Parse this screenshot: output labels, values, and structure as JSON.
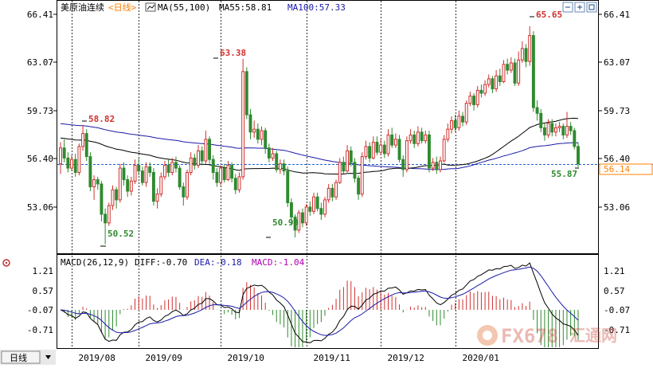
{
  "header": {
    "instrument": "美原油连续",
    "period": "<日线>",
    "ma_label": "MA(55,100)",
    "ma55_label": "MA55:58.81",
    "ma100_label": "MA100:57.33"
  },
  "price_axis": {
    "ticks": [
      "66.41",
      "63.07",
      "59.73",
      "56.40",
      "53.06"
    ],
    "current_price_tag": "56.14"
  },
  "annotations": {
    "high_label": "65.65",
    "peak_sep": "63.38",
    "start_label": "58.82",
    "low_aug": "50.52",
    "low_oct": "50.99",
    "last_low": "55.87"
  },
  "macd": {
    "header_label": "MACD(26,12,9)",
    "diff_label": "DIFF:-0.70",
    "dea_label": "DEA:-0.18",
    "macd_label": "MACD:-1.04",
    "ticks": [
      "1.21",
      "0.57",
      "-0.07",
      "-0.71"
    ]
  },
  "time_axis": {
    "period_button": "日线",
    "months": [
      "2019/08",
      "2019/09",
      "2019/10",
      "2019/11",
      "2019/12",
      "2020/01"
    ]
  },
  "watermark": {
    "text": "FX678",
    "subtext": "汇通网"
  },
  "colors": {
    "up": "#d0302e",
    "down": "#2f8a2f",
    "ma55": "#000000",
    "ma100": "#1a1aa8",
    "macd_label": "#b000b0",
    "price_tag": "#ff8000",
    "dashed_price": "#1f5fd0"
  },
  "chart_data": {
    "type": "candlestick",
    "series": [
      {
        "name": "",
        "values": [
          [
            56.1,
            57.2,
            57.6,
            55.4
          ],
          [
            57.2,
            56.5,
            57.8,
            56.2
          ],
          [
            56.5,
            55.8,
            56.9,
            55.5
          ],
          [
            55.8,
            56.4,
            56.7,
            55.6
          ],
          [
            56.4,
            55.5,
            56.8,
            55.2
          ],
          [
            55.5,
            57.3,
            57.5,
            55.3
          ],
          [
            57.3,
            58.2,
            58.8,
            57.0
          ],
          [
            58.2,
            56.6,
            58.5,
            56.3
          ],
          [
            56.6,
            54.5,
            56.9,
            54.2
          ],
          [
            54.5,
            55.0,
            55.3,
            53.6
          ],
          [
            55.0,
            54.7,
            55.2,
            54.3
          ],
          [
            54.7,
            52.6,
            54.9,
            52.1
          ],
          [
            52.6,
            52.0,
            53.0,
            50.52
          ],
          [
            52.0,
            53.2,
            53.4,
            51.8
          ],
          [
            53.2,
            54.3,
            54.6,
            52.9
          ],
          [
            54.3,
            53.6,
            54.5,
            53.0
          ],
          [
            53.6,
            55.8,
            56.1,
            53.4
          ],
          [
            55.8,
            55.0,
            56.2,
            54.6
          ],
          [
            55.0,
            54.2,
            55.3,
            53.8
          ],
          [
            54.2,
            54.9,
            55.2,
            53.9
          ],
          [
            54.9,
            56.0,
            56.4,
            54.7
          ],
          [
            56.0,
            55.6,
            56.5,
            55.3
          ],
          [
            55.6,
            54.8,
            55.9,
            54.6
          ],
          [
            54.8,
            55.9,
            56.2,
            54.5
          ],
          [
            55.9,
            55.5,
            56.2,
            55.2
          ],
          [
            55.5,
            53.5,
            55.8,
            53.2
          ],
          [
            53.5,
            54.0,
            54.4,
            53.0
          ],
          [
            54.0,
            55.2,
            55.5,
            53.8
          ],
          [
            55.2,
            56.0,
            56.3,
            55.0
          ],
          [
            56.0,
            55.5,
            56.4,
            55.2
          ],
          [
            55.5,
            56.2,
            56.5,
            55.3
          ],
          [
            56.2,
            55.8,
            56.6,
            55.5
          ],
          [
            55.8,
            54.5,
            56.0,
            54.3
          ],
          [
            54.5,
            53.8,
            54.8,
            53.2
          ],
          [
            53.8,
            55.5,
            55.7,
            53.6
          ],
          [
            55.5,
            56.5,
            56.9,
            55.3
          ],
          [
            56.5,
            56.0,
            56.8,
            55.7
          ],
          [
            56.0,
            57.0,
            57.4,
            55.8
          ],
          [
            57.0,
            56.3,
            57.3,
            56.0
          ],
          [
            56.3,
            57.8,
            58.4,
            56.1
          ],
          [
            57.8,
            56.4,
            58.0,
            56.1
          ],
          [
            56.4,
            55.5,
            56.7,
            55.0
          ],
          [
            55.5,
            54.8,
            55.8,
            54.5
          ],
          [
            54.8,
            55.8,
            56.0,
            54.6
          ],
          [
            55.8,
            55.0,
            56.1,
            54.8
          ],
          [
            55.0,
            56.0,
            56.3,
            54.9
          ],
          [
            56.0,
            55.1,
            56.2,
            54.8
          ],
          [
            55.1,
            54.3,
            55.4,
            54.0
          ],
          [
            54.3,
            55.2,
            55.5,
            54.1
          ],
          [
            55.2,
            62.5,
            63.38,
            55.0
          ],
          [
            62.5,
            59.5,
            62.8,
            59.2
          ],
          [
            59.5,
            58.3,
            59.9,
            57.8
          ],
          [
            58.3,
            58.5,
            59.1,
            57.9
          ],
          [
            58.5,
            57.8,
            58.9,
            57.5
          ],
          [
            57.8,
            58.4,
            58.7,
            57.4
          ],
          [
            58.4,
            57.2,
            58.6,
            56.8
          ],
          [
            57.2,
            56.5,
            57.5,
            56.2
          ],
          [
            56.5,
            56.8,
            57.2,
            56.3
          ],
          [
            56.8,
            55.7,
            57.0,
            55.5
          ],
          [
            55.7,
            56.1,
            56.4,
            55.4
          ],
          [
            56.1,
            55.6,
            56.4,
            55.3
          ],
          [
            55.6,
            53.4,
            55.9,
            53.1
          ],
          [
            53.4,
            52.4,
            53.7,
            51.9
          ],
          [
            52.4,
            51.5,
            52.6,
            50.99
          ],
          [
            51.5,
            52.7,
            52.9,
            51.3
          ],
          [
            52.7,
            52.0,
            53.0,
            51.7
          ],
          [
            52.0,
            53.1,
            53.3,
            51.8
          ],
          [
            53.1,
            52.8,
            53.5,
            52.5
          ],
          [
            52.8,
            53.8,
            54.1,
            52.6
          ],
          [
            53.8,
            53.0,
            54.1,
            52.8
          ],
          [
            53.0,
            52.6,
            53.4,
            52.2
          ],
          [
            52.6,
            53.6,
            53.8,
            52.4
          ],
          [
            53.6,
            54.4,
            54.7,
            53.4
          ],
          [
            54.4,
            53.8,
            54.7,
            53.5
          ],
          [
            53.8,
            54.8,
            55.0,
            53.6
          ],
          [
            54.8,
            56.2,
            56.5,
            54.7
          ],
          [
            56.2,
            55.6,
            56.6,
            55.4
          ],
          [
            55.6,
            57.0,
            57.4,
            55.5
          ],
          [
            57.0,
            56.2,
            57.3,
            55.9
          ],
          [
            56.2,
            55.1,
            56.5,
            54.8
          ],
          [
            55.1,
            54.0,
            55.3,
            53.6
          ],
          [
            54.0,
            56.6,
            56.9,
            53.8
          ],
          [
            56.6,
            57.3,
            57.7,
            56.4
          ],
          [
            57.3,
            56.5,
            57.6,
            56.2
          ],
          [
            56.5,
            57.6,
            58.0,
            56.4
          ],
          [
            57.6,
            56.9,
            58.0,
            56.7
          ],
          [
            56.9,
            57.4,
            57.8,
            56.7
          ],
          [
            57.4,
            56.8,
            57.7,
            56.5
          ],
          [
            56.8,
            58.1,
            58.5,
            56.6
          ],
          [
            58.1,
            57.4,
            58.6,
            57.2
          ],
          [
            57.4,
            57.8,
            58.2,
            57.2
          ],
          [
            57.8,
            56.4,
            58.1,
            56.2
          ],
          [
            56.4,
            55.7,
            56.7,
            55.2
          ],
          [
            55.7,
            57.7,
            58.0,
            55.5
          ],
          [
            57.7,
            58.1,
            58.5,
            57.5
          ],
          [
            58.1,
            57.5,
            58.4,
            57.2
          ],
          [
            57.5,
            58.3,
            58.7,
            57.3
          ],
          [
            58.3,
            57.7,
            58.6,
            57.5
          ],
          [
            57.7,
            58.1,
            58.4,
            57.5
          ],
          [
            58.1,
            55.8,
            58.4,
            55.5
          ],
          [
            55.8,
            56.2,
            56.5,
            55.6
          ],
          [
            56.2,
            55.7,
            56.6,
            55.4
          ],
          [
            55.7,
            56.3,
            56.6,
            55.5
          ],
          [
            56.3,
            57.8,
            58.1,
            56.2
          ],
          [
            57.8,
            58.5,
            58.9,
            57.6
          ],
          [
            58.5,
            59.1,
            59.4,
            58.2
          ],
          [
            59.1,
            58.6,
            59.5,
            58.3
          ],
          [
            58.6,
            59.4,
            59.8,
            58.4
          ],
          [
            59.4,
            59.0,
            59.7,
            58.7
          ],
          [
            59.0,
            60.3,
            60.5,
            58.8
          ],
          [
            60.3,
            60.8,
            61.1,
            60.1
          ],
          [
            60.8,
            60.2,
            61.0,
            59.8
          ],
          [
            60.2,
            61.2,
            61.5,
            60.0
          ],
          [
            61.2,
            61.0,
            61.6,
            60.7
          ],
          [
            61.0,
            61.6,
            61.9,
            60.8
          ],
          [
            61.6,
            62.0,
            62.3,
            61.4
          ],
          [
            62.0,
            61.3,
            62.2,
            61.0
          ],
          [
            61.3,
            62.2,
            62.6,
            61.1
          ],
          [
            62.2,
            61.8,
            62.7,
            61.5
          ],
          [
            61.8,
            63.0,
            63.3,
            61.7
          ],
          [
            63.0,
            62.6,
            63.4,
            62.3
          ],
          [
            62.6,
            63.1,
            63.5,
            62.4
          ],
          [
            63.1,
            61.7,
            63.4,
            61.5
          ],
          [
            61.7,
            63.3,
            63.9,
            61.5
          ],
          [
            63.3,
            64.1,
            64.6,
            63.1
          ],
          [
            64.1,
            63.2,
            64.4,
            62.8
          ],
          [
            63.2,
            65.0,
            65.65,
            62.9
          ],
          [
            65.0,
            60.0,
            65.3,
            59.7
          ],
          [
            60.0,
            59.6,
            60.5,
            59.1
          ],
          [
            59.6,
            58.6,
            59.9,
            58.3
          ],
          [
            58.6,
            58.1,
            58.9,
            57.7
          ],
          [
            58.1,
            58.9,
            59.2,
            57.9
          ],
          [
            58.9,
            58.3,
            59.2,
            58.0
          ],
          [
            58.3,
            58.6,
            58.9,
            58.0
          ],
          [
            58.6,
            58.7,
            59.0,
            58.3
          ],
          [
            58.7,
            58.1,
            58.9,
            57.8
          ],
          [
            58.1,
            58.7,
            59.7,
            57.9
          ],
          [
            58.7,
            58.4,
            59.0,
            58.1
          ],
          [
            58.4,
            57.3,
            58.6,
            57.1
          ],
          [
            57.3,
            56.1,
            57.6,
            55.87
          ]
        ]
      }
    ],
    "ohlc_order": [
      "open",
      "close",
      "high",
      "low"
    ],
    "ylim": [
      50.0,
      67.3
    ],
    "y_ticks": [
      66.41,
      63.07,
      59.73,
      56.4,
      53.06
    ],
    "x_months": [
      "2019/08",
      "2019/09",
      "2019/10",
      "2019/11",
      "2019/12",
      "2020/01"
    ],
    "month_start_index": [
      3,
      21,
      43,
      66,
      86,
      106
    ]
  }
}
